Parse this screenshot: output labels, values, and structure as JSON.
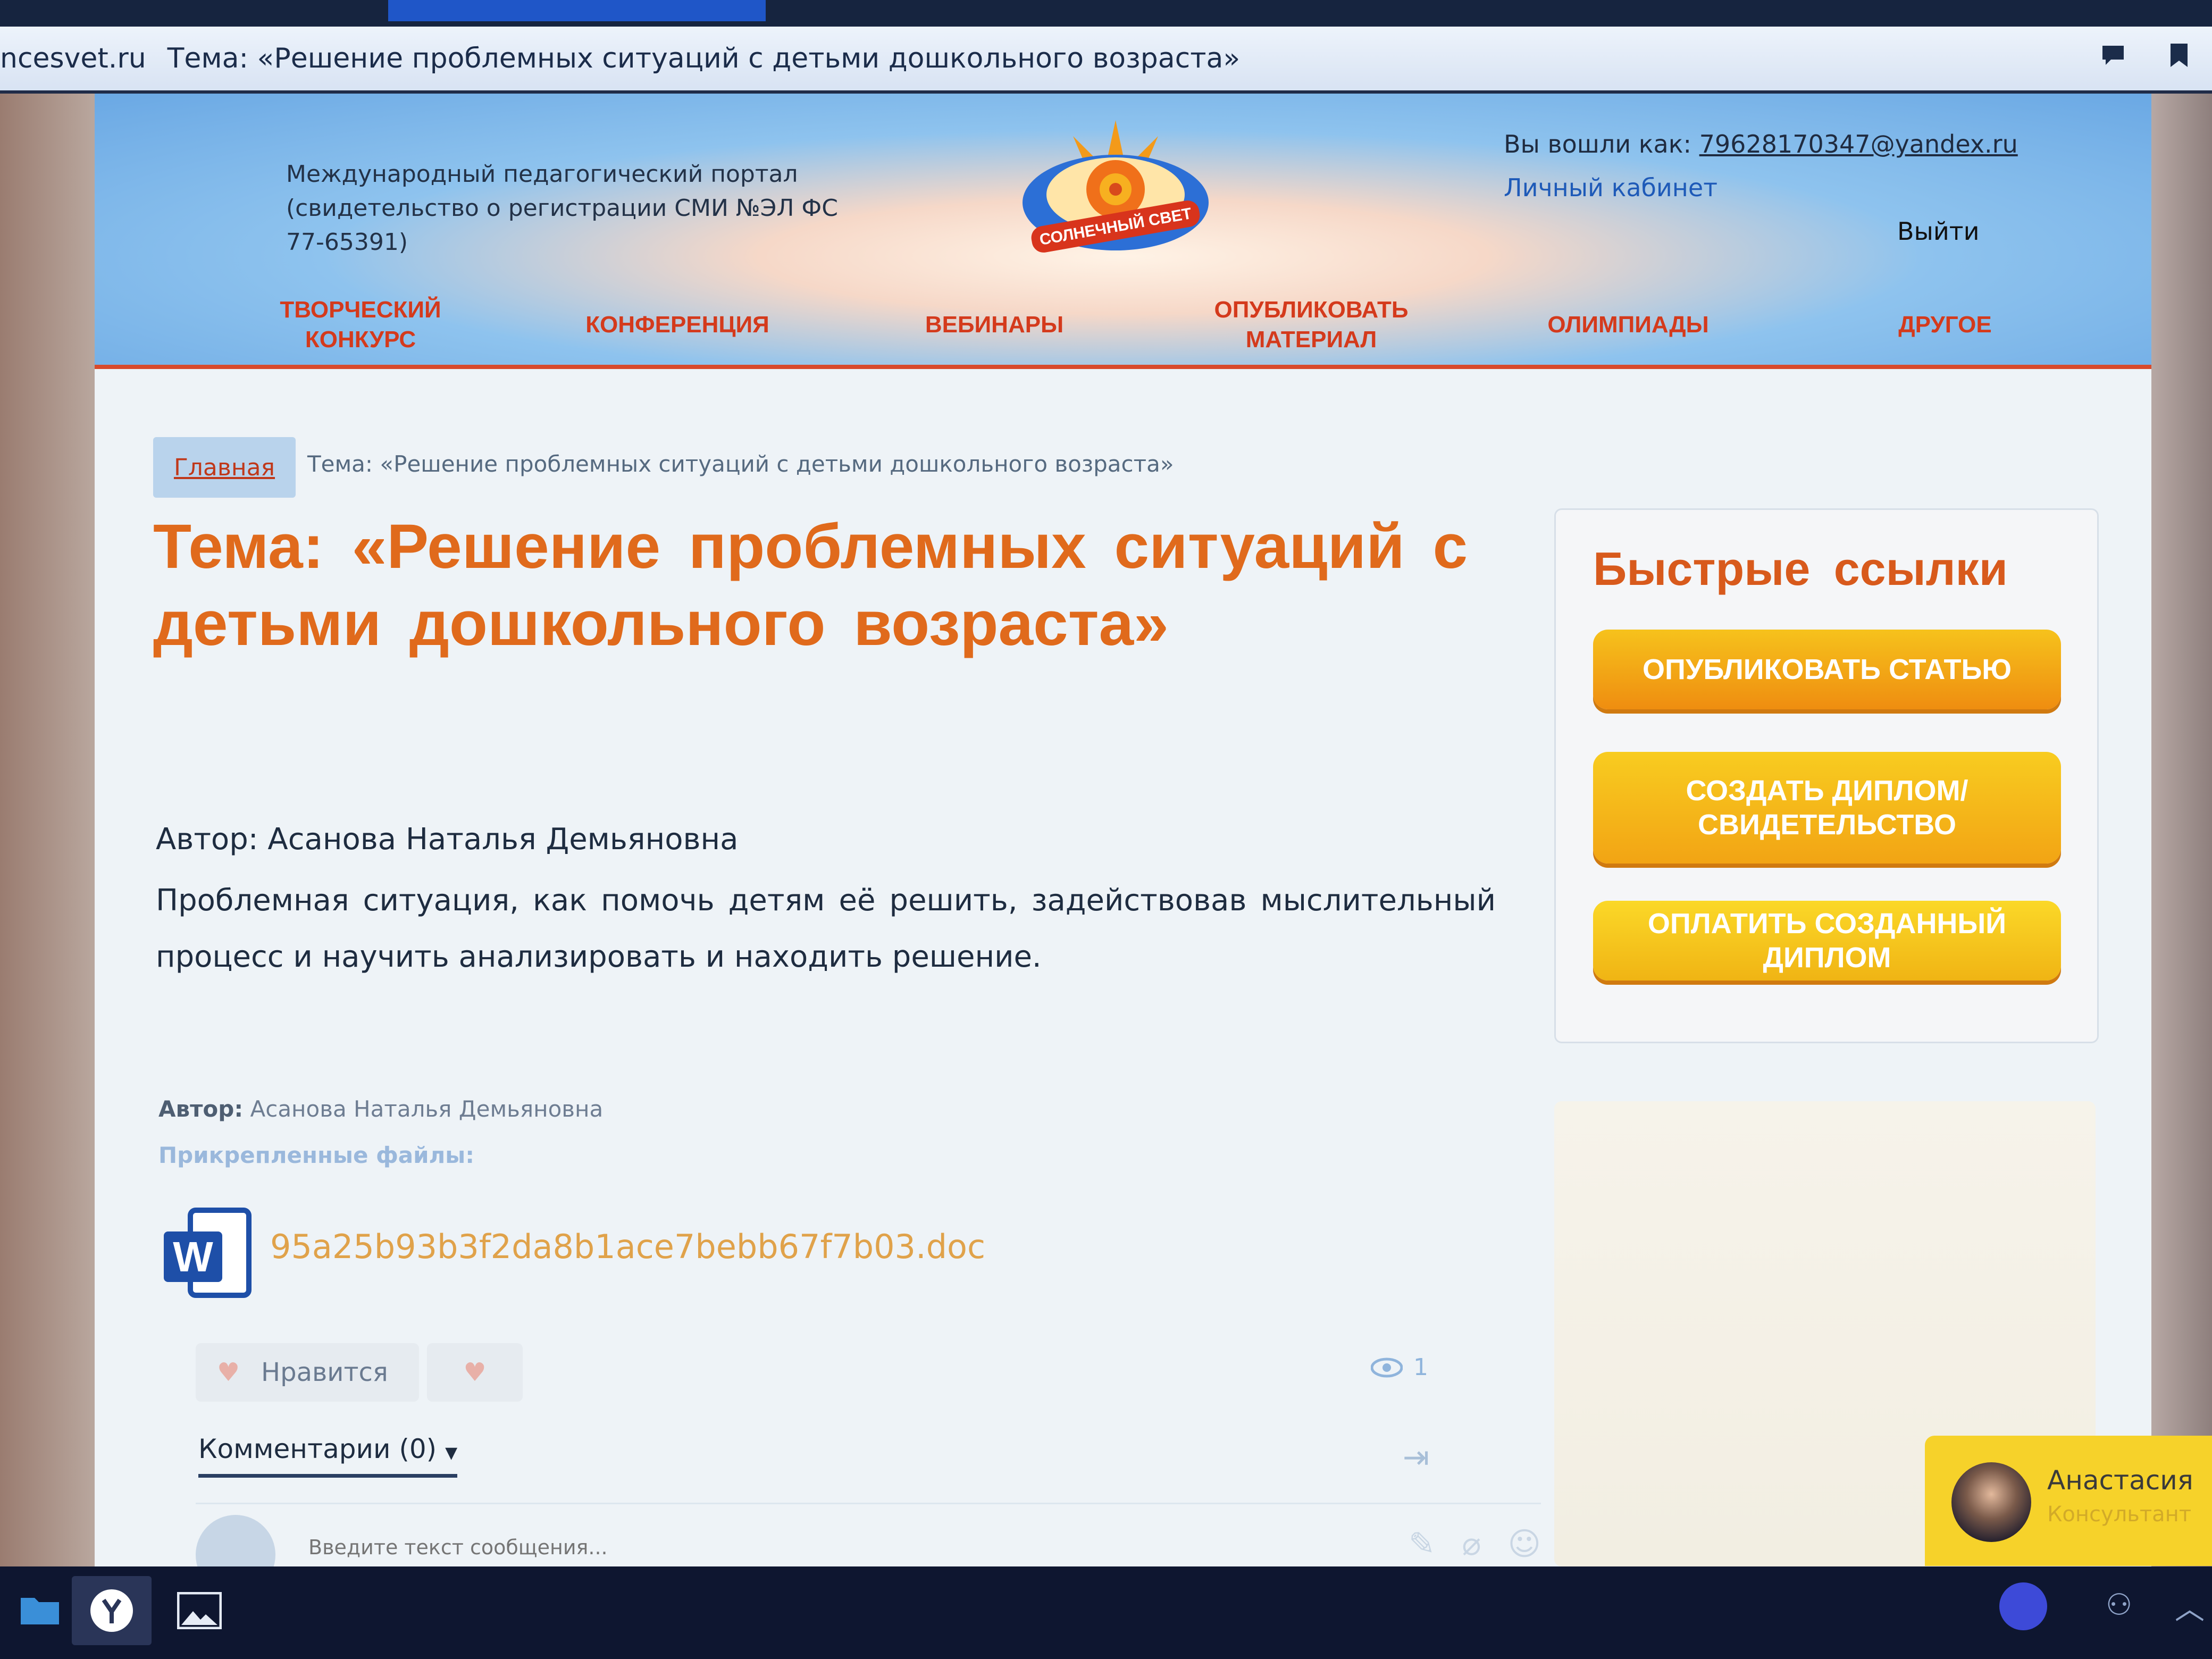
{
  "browser": {
    "domain": "ncesvet.ru",
    "tab_title": "Тема: «Решение проблемных ситуаций с детьми дошкольного возраста»"
  },
  "header": {
    "portal_description": "Международный педагогический портал (свидетельство о регистрации СМИ №ЭЛ ФС 77-65391)",
    "logo_text": "СОЛНЕЧНЫЙ СВЕТ",
    "login_label": "Вы вошли как: ",
    "login_email": "79628170347@yandex.ru",
    "cabinet_link": "Личный кабинет",
    "logout": "Выйти",
    "nav": [
      {
        "label": "ТВОРЧЕСКИЙ\nКОНКУРС"
      },
      {
        "label": "КОНФЕРЕНЦИЯ"
      },
      {
        "label": "ВЕБИНАРЫ"
      },
      {
        "label": "ОПУБЛИКОВАТЬ\nМАТЕРИАЛ"
      },
      {
        "label": "ОЛИМПИАДЫ"
      },
      {
        "label": "ДРУГОЕ"
      }
    ]
  },
  "breadcrumb": {
    "home": "Главная",
    "current": "Тема: «Решение проблемных ситуаций с детьми дошкольного возраста»"
  },
  "article": {
    "title": "Тема: «Решение проблемных ситуаций с детьми дошкольного возраста»",
    "author_line": "Автор: Асанова Наталья Демьяновна",
    "body": "Проблемная ситуация, как помочь детям её  решить, задействовав мыслительный процесс и научить анализировать и находить решение.",
    "meta_author_label": "Автор:",
    "meta_author_name": " Асанова Наталья Демьяновна",
    "attached_files_label": "Прикрепленные файлы:",
    "file_name": "95a25b93b3f2da8b1ace7bebb67f7b03.doc",
    "like_label": "Нравится",
    "views_count": "1",
    "comments_tab": "Комментарии (0)",
    "comment_placeholder": "Введите текст сообщения..."
  },
  "sidebar": {
    "title": "Быстрые ссылки",
    "buttons": [
      {
        "label": "ОПУБЛИКОВАТЬ СТАТЬЮ"
      },
      {
        "label": "СОЗДАТЬ ДИПЛОМ/\nСВИДЕТЕЛЬСТВО"
      },
      {
        "label": "ОПЛАТИТЬ СОЗДАННЫЙ ДИПЛОМ"
      }
    ]
  },
  "chat": {
    "name": "Анастасия",
    "role": "Консультант"
  },
  "colors": {
    "accent_orange": "#e06a1c",
    "nav_red": "#d43a1c",
    "button_yellow": "#f6c21c",
    "link_blue": "#1e5ab8"
  },
  "icons": [
    "comment-icon",
    "bookmark-icon",
    "word-doc-icon",
    "heart-icon",
    "eye-icon",
    "login-icon",
    "pencil-icon",
    "paperclip-icon",
    "smile-icon",
    "folder-icon",
    "yandex-browser-icon",
    "photos-icon",
    "mic-icon",
    "people-icon",
    "chevron-up-icon"
  ]
}
